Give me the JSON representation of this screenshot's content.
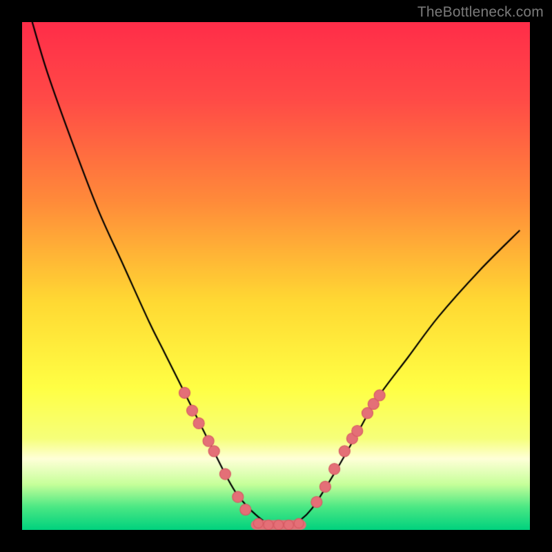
{
  "watermark": "TheBottleneck.com",
  "colors": {
    "frame": "#000000",
    "curve": "#000000",
    "point_fill": "#e46f77",
    "point_stroke": "#d65a63",
    "gradient_stops": [
      {
        "t": 0.0,
        "color": "#ff2d49"
      },
      {
        "t": 0.15,
        "color": "#ff4a47"
      },
      {
        "t": 0.35,
        "color": "#ff8a3a"
      },
      {
        "t": 0.55,
        "color": "#ffd933"
      },
      {
        "t": 0.72,
        "color": "#ffff44"
      },
      {
        "t": 0.82,
        "color": "#f6ff7a"
      },
      {
        "t": 0.86,
        "color": "#ffffd8"
      },
      {
        "t": 0.91,
        "color": "#c7ff9a"
      },
      {
        "t": 0.955,
        "color": "#4be884"
      },
      {
        "t": 1.0,
        "color": "#00d27e"
      }
    ]
  },
  "chart_data": {
    "type": "line",
    "title": "",
    "xlabel": "",
    "ylabel": "",
    "xlim": [
      0,
      100
    ],
    "ylim": [
      0,
      100
    ],
    "series": [
      {
        "name": "bottleneck-curve",
        "x": [
          2,
          5,
          10,
          15,
          20,
          25,
          28,
          32,
          36,
          40,
          42,
          44,
          46,
          48,
          50,
          52,
          54,
          56,
          58,
          62,
          66,
          70,
          76,
          82,
          90,
          98
        ],
        "y": [
          100,
          90,
          76,
          63,
          52,
          41,
          35,
          27,
          19,
          11,
          7.5,
          5,
          3,
          1.5,
          1,
          1,
          1.5,
          3,
          5.5,
          12,
          19,
          26,
          34,
          42,
          51,
          59
        ]
      }
    ],
    "flat_segment": {
      "x_from": 46,
      "x_to": 55,
      "y": 1.0
    },
    "points_left_branch": [
      {
        "x": 32.0,
        "y": 27.0
      },
      {
        "x": 33.5,
        "y": 23.5
      },
      {
        "x": 34.8,
        "y": 21.0
      },
      {
        "x": 36.7,
        "y": 17.5
      },
      {
        "x": 37.8,
        "y": 15.5
      },
      {
        "x": 40.0,
        "y": 11.0
      },
      {
        "x": 42.5,
        "y": 6.5
      },
      {
        "x": 44.0,
        "y": 4.0
      }
    ],
    "points_flat": [
      {
        "x": 46.5,
        "y": 1.3
      },
      {
        "x": 48.5,
        "y": 1.0
      },
      {
        "x": 50.5,
        "y": 1.0
      },
      {
        "x": 52.5,
        "y": 1.0
      },
      {
        "x": 54.5,
        "y": 1.3
      }
    ],
    "points_right_branch": [
      {
        "x": 58.0,
        "y": 5.5
      },
      {
        "x": 59.7,
        "y": 8.5
      },
      {
        "x": 61.5,
        "y": 12.0
      },
      {
        "x": 63.5,
        "y": 15.5
      },
      {
        "x": 65.0,
        "y": 18.0
      },
      {
        "x": 66.0,
        "y": 19.5
      },
      {
        "x": 68.0,
        "y": 23.0
      },
      {
        "x": 69.2,
        "y": 24.8
      },
      {
        "x": 70.4,
        "y": 26.5
      }
    ]
  }
}
